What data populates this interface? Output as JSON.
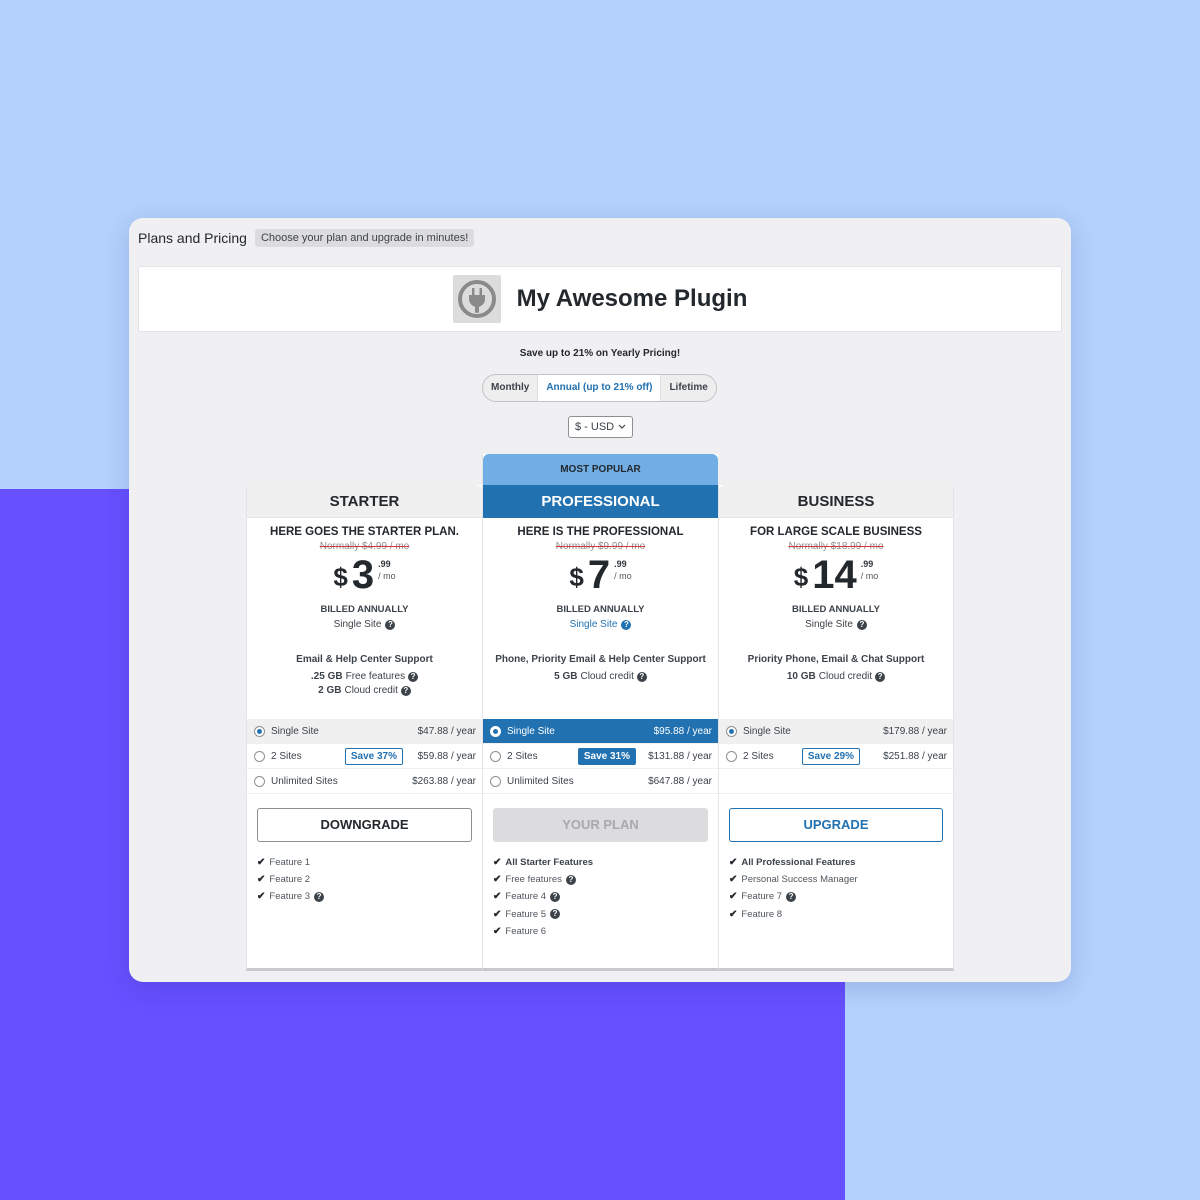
{
  "page": {
    "title": "Plans and Pricing",
    "subtitle": "Choose your plan and upgrade in minutes!"
  },
  "header": {
    "plugin_name": "My Awesome Plugin",
    "icon": "plug-icon"
  },
  "billing": {
    "save_note": "Save up to 21% on Yearly Pricing!",
    "cycles": [
      {
        "label": "Monthly",
        "active": false
      },
      {
        "label": "Annual (up to 21% off)",
        "active": true
      },
      {
        "label": "Lifetime",
        "active": false
      }
    ],
    "currency": "$ - USD"
  },
  "plans": [
    {
      "name": "STARTER",
      "description": "HERE GOES THE STARTER PLAN.",
      "normally": "Normally $4.99 / mo",
      "currency_symbol": "$",
      "price_int": "3",
      "price_cents": ".99",
      "price_unit": "/ mo",
      "billed": "BILLED ANNUALLY",
      "sites": "Single Site",
      "support": "Email & Help Center Support",
      "quotas": [
        {
          "amount": ".25 GB",
          "label": "Free features"
        },
        {
          "amount": "2 GB",
          "label": "Cloud credit"
        }
      ],
      "pricing_options": [
        {
          "label": "Single Site",
          "price": "$47.88 / year",
          "selected": true,
          "save": ""
        },
        {
          "label": "2 Sites",
          "price": "$59.88 / year",
          "selected": false,
          "save": "Save 37%"
        },
        {
          "label": "Unlimited Sites",
          "price": "$263.88 / year",
          "selected": false,
          "save": ""
        }
      ],
      "cta": "DOWNGRADE",
      "features": [
        {
          "label": "Feature 1",
          "bold": false,
          "help": false
        },
        {
          "label": "Feature 2",
          "bold": false,
          "help": false
        },
        {
          "label": "Feature 3",
          "bold": false,
          "help": true
        }
      ]
    },
    {
      "badge": "MOST POPULAR",
      "name": "PROFESSIONAL",
      "description": "HERE IS THE PROFESSIONAL",
      "normally": "Normally $9.99 / mo",
      "currency_symbol": "$",
      "price_int": "7",
      "price_cents": ".99",
      "price_unit": "/ mo",
      "billed": "BILLED ANNUALLY",
      "sites": "Single Site",
      "support": "Phone, Priority Email & Help Center Support",
      "quotas": [
        {
          "amount": "5 GB",
          "label": "Cloud credit"
        }
      ],
      "pricing_options": [
        {
          "label": "Single Site",
          "price": "$95.88 / year",
          "selected": true,
          "save": ""
        },
        {
          "label": "2 Sites",
          "price": "$131.88 / year",
          "selected": false,
          "save": "Save 31%"
        },
        {
          "label": "Unlimited Sites",
          "price": "$647.88 / year",
          "selected": false,
          "save": ""
        }
      ],
      "cta": "YOUR PLAN",
      "features": [
        {
          "label": "All Starter Features",
          "bold": true,
          "help": false
        },
        {
          "label": "Free features",
          "bold": false,
          "help": true
        },
        {
          "label": "Feature 4",
          "bold": false,
          "help": true
        },
        {
          "label": "Feature 5",
          "bold": false,
          "help": true
        },
        {
          "label": "Feature 6",
          "bold": false,
          "help": false
        }
      ]
    },
    {
      "name": "BUSINESS",
      "description": "FOR LARGE SCALE BUSINESS",
      "normally": "Normally $18.99 / mo",
      "currency_symbol": "$",
      "price_int": "14",
      "price_cents": ".99",
      "price_unit": "/ mo",
      "billed": "BILLED ANNUALLY",
      "sites": "Single Site",
      "support": "Priority Phone, Email & Chat Support",
      "quotas": [
        {
          "amount": "10 GB",
          "label": "Cloud credit"
        }
      ],
      "pricing_options": [
        {
          "label": "Single Site",
          "price": "$179.88 / year",
          "selected": true,
          "save": ""
        },
        {
          "label": "2 Sites",
          "price": "$251.88 / year",
          "selected": false,
          "save": "Save 29%"
        }
      ],
      "cta": "UPGRADE",
      "features": [
        {
          "label": "All Professional Features",
          "bold": true,
          "help": false
        },
        {
          "label": "Personal Success Manager",
          "bold": false,
          "help": false
        },
        {
          "label": "Feature 7",
          "bold": false,
          "help": true
        },
        {
          "label": "Feature 8",
          "bold": false,
          "help": false
        }
      ]
    }
  ]
}
